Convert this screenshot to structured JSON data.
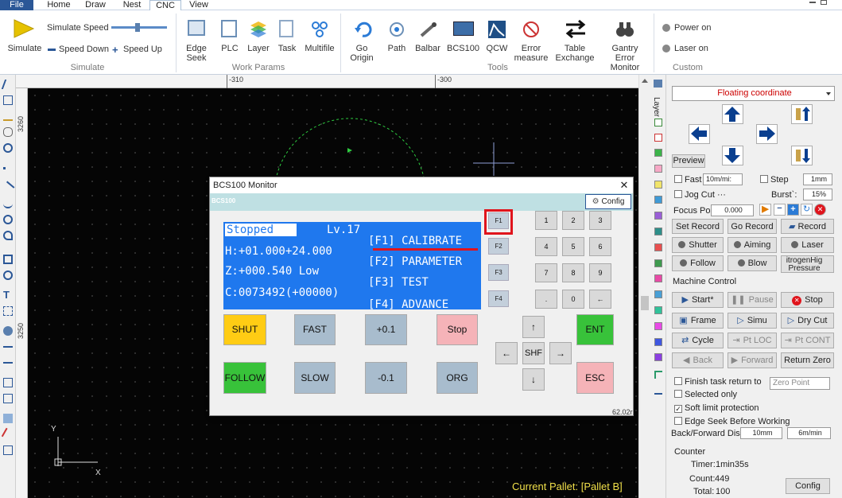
{
  "menu": {
    "file": "File",
    "home": "Home",
    "draw": "Draw",
    "nest": "Nest",
    "cnc": "CNC",
    "view": "View"
  },
  "ribbon": {
    "simulate": "Simulate",
    "simulate_speed": "Simulate Speed",
    "speed_down": "Speed Down",
    "speed_up": "Speed Up",
    "edge_seek": "Edge Seek",
    "plc": "PLC",
    "layer": "Layer",
    "task": "Task",
    "multifile": "Multifile",
    "go_origin": "Go Origin",
    "path": "Path",
    "ballbar": "Balbar",
    "bcs100": "BCS100",
    "qcw": "QCW",
    "error_measure": "Error measure",
    "table_exchange": "Table Exchange",
    "gantry_monitor": "Gantry Error Monitor",
    "power_on": "Power on",
    "laser_on": "Laser on",
    "groups": {
      "simulate": "Simulate",
      "work_params": "Work Params",
      "tools": "Tools",
      "custom": "Custom"
    }
  },
  "ruler": {
    "h1": "-310",
    "h2": "-300",
    "v1": "3260",
    "v2": "3250"
  },
  "canvas": {
    "current_pallet": "Current Pallet: [Pallet B]",
    "axis_x": "X",
    "axis_y": "Y"
  },
  "layer_tab": "Layer",
  "layer_colors": [
    "#3cb34a",
    "#f7a8c6",
    "#f1e46a",
    "#3f9ad6",
    "#9a5fd6",
    "#2e8f8a",
    "#e85050",
    "#3e9a4e",
    "#e84aa6",
    "#4aa0d6",
    "#31c29a",
    "#e84ae6",
    "#3f57e0",
    "#8b3fe0"
  ],
  "monitor": {
    "title": "BCS100 Monitor",
    "sub": "BCS100",
    "config": "Config",
    "version": "62.02r",
    "screen": {
      "status": "Stopped",
      "level": "Lv.17",
      "h": "H:+01.000+24.000",
      "z": "Z:+000.540 Low",
      "c": "C:0073492(+00000)",
      "f1": "[F1] CALIBRATE",
      "f2": "[F2] PARAMETER",
      "f3": "[F3] TEST",
      "f4": "[F4] ADVANCE"
    },
    "fkeys": [
      "F1",
      "F2",
      "F3",
      "F4"
    ],
    "numpad": [
      "1",
      "2",
      "3",
      "4",
      "5",
      "6",
      "7",
      "8",
      "9",
      ".",
      "0",
      "←"
    ],
    "buttons": {
      "shut": "SHUT",
      "fast": "FAST",
      "plus": "+0.1",
      "stop": "Stop",
      "follow": "FOLLOW",
      "slow": "SLOW",
      "minus": "-0.1",
      "org": "ORG",
      "ent": "ENT",
      "esc": "ESC",
      "shf": "SHF",
      "up": "↑",
      "down": "↓",
      "left": "←",
      "right": "→"
    }
  },
  "panel": {
    "coord": "Floating coordinate",
    "preview": "Preview",
    "fast": "Fast",
    "fast_speed": "10m/mi:",
    "step": "Step",
    "step_val": "1mm",
    "jog_cut": "Jog Cut ···",
    "burst": "Burst`:",
    "burst_val": "15%",
    "focus_pos": "Focus Pos",
    "focus_val": "0.000",
    "set_record": "Set Record",
    "go_record": "Go Record",
    "record": "Record",
    "shutter": "Shutter",
    "aiming": "Aiming",
    "laser": "Laser",
    "follow": "Follow",
    "blow": "Blow",
    "pressure": "itrogenHig Pressure",
    "machine_control": "Machine Control",
    "start": "Start*",
    "pause": "Pause",
    "stop": "Stop",
    "frame": "Frame",
    "simu": "Simu",
    "dry_cut": "Dry Cut",
    "cycle": "Cycle",
    "pt_loc": "Pt LOC",
    "pt_cont": "Pt CONT",
    "back": "Back",
    "forward": "Forward",
    "return_zero": "Return Zero",
    "finish_task": "Finish task return to",
    "zero_point": "Zero Point",
    "selected_only": "Selected only",
    "soft_limit": "Soft limit protection",
    "edge_seek": "Edge Seek Before Working",
    "bf_dis": "Back/Forward Dis:",
    "bf_val": "10mm",
    "bf_speed": "6m/min",
    "counter": "Counter",
    "timer": "Timer:",
    "timer_val": "1min35s",
    "count": "Count:",
    "count_val": "449",
    "total": "Total:",
    "total_val": "100",
    "config": "Config"
  },
  "colors": {
    "accent": "#2b5797",
    "screen": "#1f78ee",
    "highlight": "#e0141c",
    "shut": "#ffcc14",
    "follow": "#38c23a",
    "stop": "#f5b3b8",
    "ent": "#38c23a",
    "esc": "#f5b3b8"
  }
}
